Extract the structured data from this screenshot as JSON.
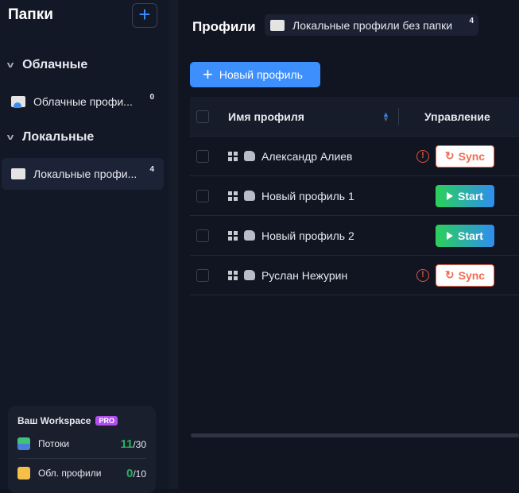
{
  "sidebar": {
    "title": "Папки",
    "groups": [
      {
        "label": "Облачные",
        "folders": [
          {
            "label": "Облачные профи...",
            "count": "0"
          }
        ]
      },
      {
        "label": "Локальные",
        "folders": [
          {
            "label": "Локальные профи...",
            "count": "4"
          }
        ]
      }
    ],
    "workspace": {
      "title": "Ваш Workspace",
      "badge": "PRO",
      "rows": [
        {
          "label": "Потоки",
          "used": "11",
          "total": "/30"
        },
        {
          "label": "Обл. профили",
          "used": "0",
          "total": "/10"
        }
      ]
    }
  },
  "main": {
    "title": "Профили",
    "breadcrumb": {
      "label": "Локальные профили без папки",
      "count": "4"
    },
    "new_button": "Новый профиль",
    "table": {
      "columns": [
        "Имя профиля",
        "Управление"
      ],
      "rows": [
        {
          "name": "Александр Алиев",
          "action": "Sync",
          "warning": true
        },
        {
          "name": "Новый профиль 1",
          "action": "Start",
          "warning": false
        },
        {
          "name": "Новый профиль 2",
          "action": "Start",
          "warning": false
        },
        {
          "name": "Руслан Нежурин",
          "action": "Sync",
          "warning": true
        }
      ]
    }
  }
}
